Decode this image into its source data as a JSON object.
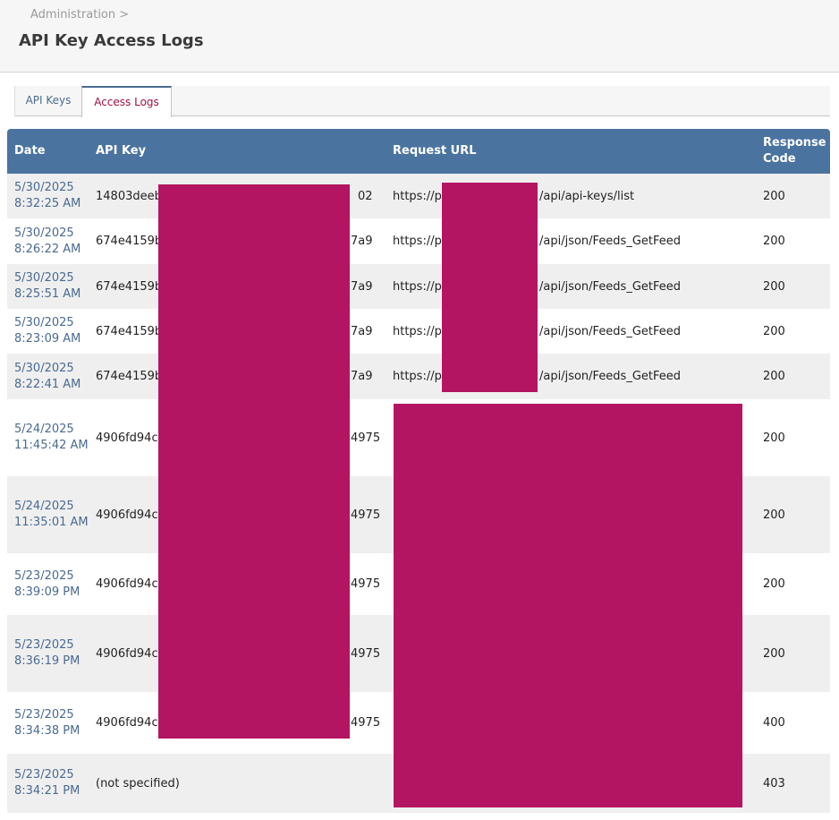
{
  "header": {
    "breadcrumb": "Administration >",
    "title": "API Key Access Logs"
  },
  "tabs": [
    {
      "label": "API Keys",
      "active": false
    },
    {
      "label": "Access Logs",
      "active": true
    }
  ],
  "table": {
    "columns": {
      "date": "Date",
      "api_key": "API Key",
      "request_url": "Request URL",
      "response_code_1": "Response",
      "response_code_2": "Code"
    },
    "rows": [
      {
        "date": "5/30/2025",
        "time": "8:32:25 AM",
        "key_start": "14803deeb",
        "key_end": "02",
        "url_start": "https://p",
        "url_end": "/api/api-keys/list",
        "code": "200"
      },
      {
        "date": "5/30/2025",
        "time": "8:26:22 AM",
        "key_start": "674e4159b",
        "key_end": "7a9",
        "url_start": "https://p",
        "url_end": "/api/json/Feeds_GetFeed",
        "code": "200"
      },
      {
        "date": "5/30/2025",
        "time": "8:25:51 AM",
        "key_start": "674e4159b",
        "key_end": "7a9",
        "url_start": "https://p",
        "url_end": "/api/json/Feeds_GetFeed",
        "code": "200"
      },
      {
        "date": "5/30/2025",
        "time": "8:23:09 AM",
        "key_start": "674e4159b",
        "key_end": "7a9",
        "url_start": "https://p",
        "url_end": "/api/json/Feeds_GetFeed",
        "code": "200"
      },
      {
        "date": "5/30/2025",
        "time": "8:22:41 AM",
        "key_start": "674e4159b",
        "key_end": "7a9",
        "url_start": "https://p",
        "url_end": "/api/json/Feeds_GetFeed",
        "code": "200"
      },
      {
        "date": "5/24/2025",
        "time": "11:45:42 AM",
        "key_start": "4906fd94c",
        "key_end": "4975",
        "url_start": "",
        "url_end": "",
        "code": "200"
      },
      {
        "date": "5/24/2025",
        "time": "11:35:01 AM",
        "key_start": "4906fd94c",
        "key_end": "4975",
        "url_start": "",
        "url_end": "",
        "code": "200"
      },
      {
        "date": "5/23/2025",
        "time": "8:39:09 PM",
        "key_start": "4906fd94c",
        "key_end": "4975",
        "url_start": "",
        "url_end": "",
        "code": "200"
      },
      {
        "date": "5/23/2025",
        "time": "8:36:19 PM",
        "key_start": "4906fd94c",
        "key_end": "4975",
        "url_start": "",
        "url_end": "",
        "code": "200"
      },
      {
        "date": "5/23/2025",
        "time": "8:34:38 PM",
        "key_start": "4906fd94c",
        "key_end": "4975",
        "url_start": "",
        "url_end": "",
        "code": "400"
      },
      {
        "date": "5/23/2025",
        "time": "8:34:21 PM",
        "key_start": "(not specified)",
        "key_end": "",
        "url_start": "",
        "url_end": "",
        "code": "403"
      }
    ]
  },
  "redaction_color": "#b31562"
}
